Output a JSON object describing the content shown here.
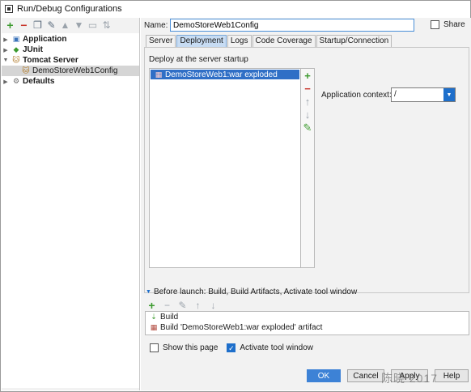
{
  "window": {
    "title": "Run/Debug Configurations"
  },
  "left_toolbar": [
    "add-icon",
    "remove-icon",
    "copy-icon",
    "settings-icon",
    "move-up-icon",
    "move-down-icon",
    "folder-icon",
    "sort-icon"
  ],
  "tree": {
    "application": "Application",
    "junit": "JUnit",
    "tomcat": "Tomcat Server",
    "tomcat_child": "DemoStoreWeb1Config",
    "defaults": "Defaults"
  },
  "name": {
    "label": "Name:",
    "value": "DemoStoreWeb1Config"
  },
  "share": {
    "label": "Share",
    "checked": false
  },
  "tabs": [
    "Server",
    "Deployment",
    "Logs",
    "Code Coverage",
    "Startup/Connection"
  ],
  "deployment": {
    "label": "Deploy at the server startup",
    "items": [
      "DemoStoreWeb1:war exploded"
    ],
    "context_label": "Application context:",
    "context_value": "/"
  },
  "before_launch": {
    "header": "Before launch: Build, Build Artifacts, Activate tool window",
    "items": [
      "Build",
      "Build 'DemoStoreWeb1:war exploded' artifact"
    ]
  },
  "options": {
    "show_page": {
      "label": "Show this page",
      "checked": false
    },
    "activate": {
      "label": "Activate tool window",
      "checked": true
    }
  },
  "buttons": {
    "ok": "OK",
    "cancel": "Cancel",
    "apply": "Apply",
    "help": "Help"
  },
  "watermark": "陈晓 2017",
  "colors": {
    "accent": "#1e6fcb",
    "selection": "#2f6fc6",
    "add": "#3c9a2e",
    "remove": "#c8352b"
  }
}
